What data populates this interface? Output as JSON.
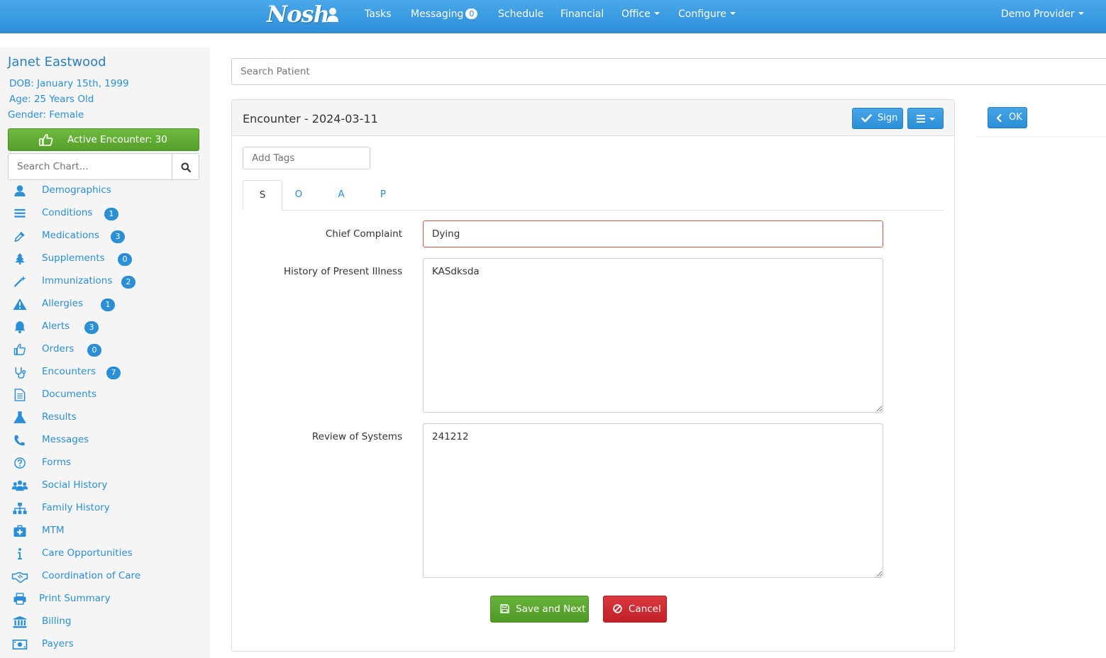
{
  "app": {
    "brand": "Nosh"
  },
  "nav": {
    "tasks": "Tasks",
    "messaging": "Messaging",
    "messaging_count": "0",
    "schedule": "Schedule",
    "financial": "Financial",
    "office": "Office",
    "configure": "Configure",
    "user": "Demo Provider"
  },
  "patient": {
    "name": "Janet Eastwood",
    "dob": "DOB: January 15th, 1999",
    "age": "Age: 25 Years Old",
    "gender": "Gender: Female"
  },
  "active_encounter": "Active Encounter: 30",
  "chart_search": {
    "placeholder": "Search Chart..."
  },
  "menu": [
    {
      "label": "Demographics",
      "icon": "user-icon"
    },
    {
      "label": "Conditions",
      "icon": "bars-icon",
      "badge": "1"
    },
    {
      "label": "Medications",
      "icon": "eyedropper-icon",
      "badge": "3"
    },
    {
      "label": "Supplements",
      "icon": "tree-icon",
      "badge": "0"
    },
    {
      "label": "Immunizations",
      "icon": "magic-wand-icon",
      "badge": "2"
    },
    {
      "label": "Allergies",
      "icon": "warning-icon",
      "badge": "1"
    },
    {
      "label": "Alerts",
      "icon": "bell-icon",
      "badge": "3"
    },
    {
      "label": "Orders",
      "icon": "thumbs-up-icon",
      "badge": "0"
    },
    {
      "label": "Encounters",
      "icon": "stethoscope-icon",
      "badge": "7"
    },
    {
      "label": "Documents",
      "icon": "document-icon"
    },
    {
      "label": "Results",
      "icon": "flask-icon"
    },
    {
      "label": "Messages",
      "icon": "phone-icon"
    },
    {
      "label": "Forms",
      "icon": "question-circle-icon"
    },
    {
      "label": "Social History",
      "icon": "users-icon"
    },
    {
      "label": "Family History",
      "icon": "sitemap-icon"
    },
    {
      "label": "MTM",
      "icon": "medkit-icon"
    },
    {
      "label": "Care Opportunities",
      "icon": "info-icon"
    },
    {
      "label": "Coordination of Care",
      "icon": "handshake-icon"
    },
    {
      "label": "Print Summary",
      "icon": "print-icon"
    },
    {
      "label": "Billing",
      "icon": "bank-icon"
    },
    {
      "label": "Payers",
      "icon": "money-icon"
    }
  ],
  "search_patient": {
    "placeholder": "Search Patient"
  },
  "encounter": {
    "title": "Encounter - 2024-03-11",
    "sign_label": "Sign",
    "tags_placeholder": "Add Tags",
    "tabs": [
      "S",
      "O",
      "A",
      "P"
    ],
    "active_tab": "S",
    "fields": {
      "chief_complaint_label": "Chief Complaint",
      "chief_complaint_value": "Dying",
      "hpi_label": "History of Present Illness",
      "hpi_value": "KASdksda",
      "ros_label": "Review of Systems",
      "ros_value": "241212"
    },
    "save_label": "Save and Next",
    "cancel_label": "Cancel"
  },
  "ok_label": "OK",
  "colors": {
    "nav_blue": "#2d8fd8",
    "link_blue": "#2a8fd6",
    "success_green": "#5cb85c",
    "danger_red": "#c9302c"
  }
}
